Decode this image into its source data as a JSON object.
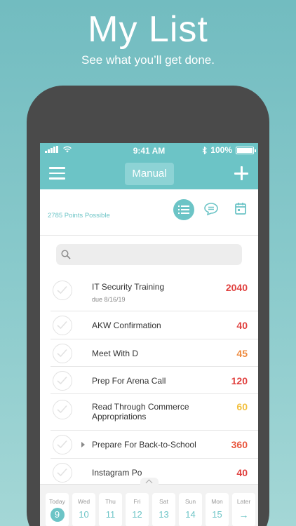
{
  "promo": {
    "headline": "My List",
    "tagline": "See what you’ll get done."
  },
  "status_bar": {
    "time": "9:41 AM",
    "battery": "100%",
    "battery_level": 1.0
  },
  "nav": {
    "title": "Manual",
    "menu_icon": "hamburger-menu-icon",
    "add_icon": "plus-icon"
  },
  "summary": {
    "points": "2785 Points Possible"
  },
  "view_toggle": {
    "selected": "list",
    "icons": [
      "list-icon",
      "chat-bubble-icon",
      "calendar-icon"
    ]
  },
  "search": {
    "placeholder": ""
  },
  "tasks": [
    {
      "title": "IT Security Training",
      "due": "due 8/16/19",
      "points": "2040",
      "color": "#e0413f",
      "expandable": false
    },
    {
      "title": "AKW Confirmation",
      "due": "",
      "points": "40",
      "color": "#e0413f",
      "expandable": false
    },
    {
      "title": "Meet With D",
      "due": "",
      "points": "45",
      "color": "#ee8a3e",
      "expandable": false
    },
    {
      "title": "Prep For Arena Call",
      "due": "",
      "points": "120",
      "color": "#e0413f",
      "expandable": false
    },
    {
      "title": "Read Through Commerce Appropriations",
      "due": "",
      "points": "60",
      "color": "#f2c03f",
      "expandable": false
    },
    {
      "title": "Prepare For Back-to-School",
      "due": "",
      "points": "360",
      "color": "#e9573f",
      "expandable": true
    },
    {
      "title": "Instagram Po",
      "due": "",
      "points": "40",
      "color": "#e0413f",
      "expandable": false
    }
  ],
  "days": [
    {
      "name": "Today",
      "num": "9"
    },
    {
      "name": "Wed",
      "num": "10"
    },
    {
      "name": "Thu",
      "num": "11"
    },
    {
      "name": "Fri",
      "num": "12"
    },
    {
      "name": "Sat",
      "num": "13"
    },
    {
      "name": "Sun",
      "num": "14"
    },
    {
      "name": "Mon",
      "num": "15"
    },
    {
      "name": "Later",
      "num": "→"
    }
  ],
  "colors": {
    "accent": "#6cc4c6",
    "points_red": "#e0413f",
    "points_orange": "#ee8a3e",
    "points_yellow": "#f2c03f"
  }
}
